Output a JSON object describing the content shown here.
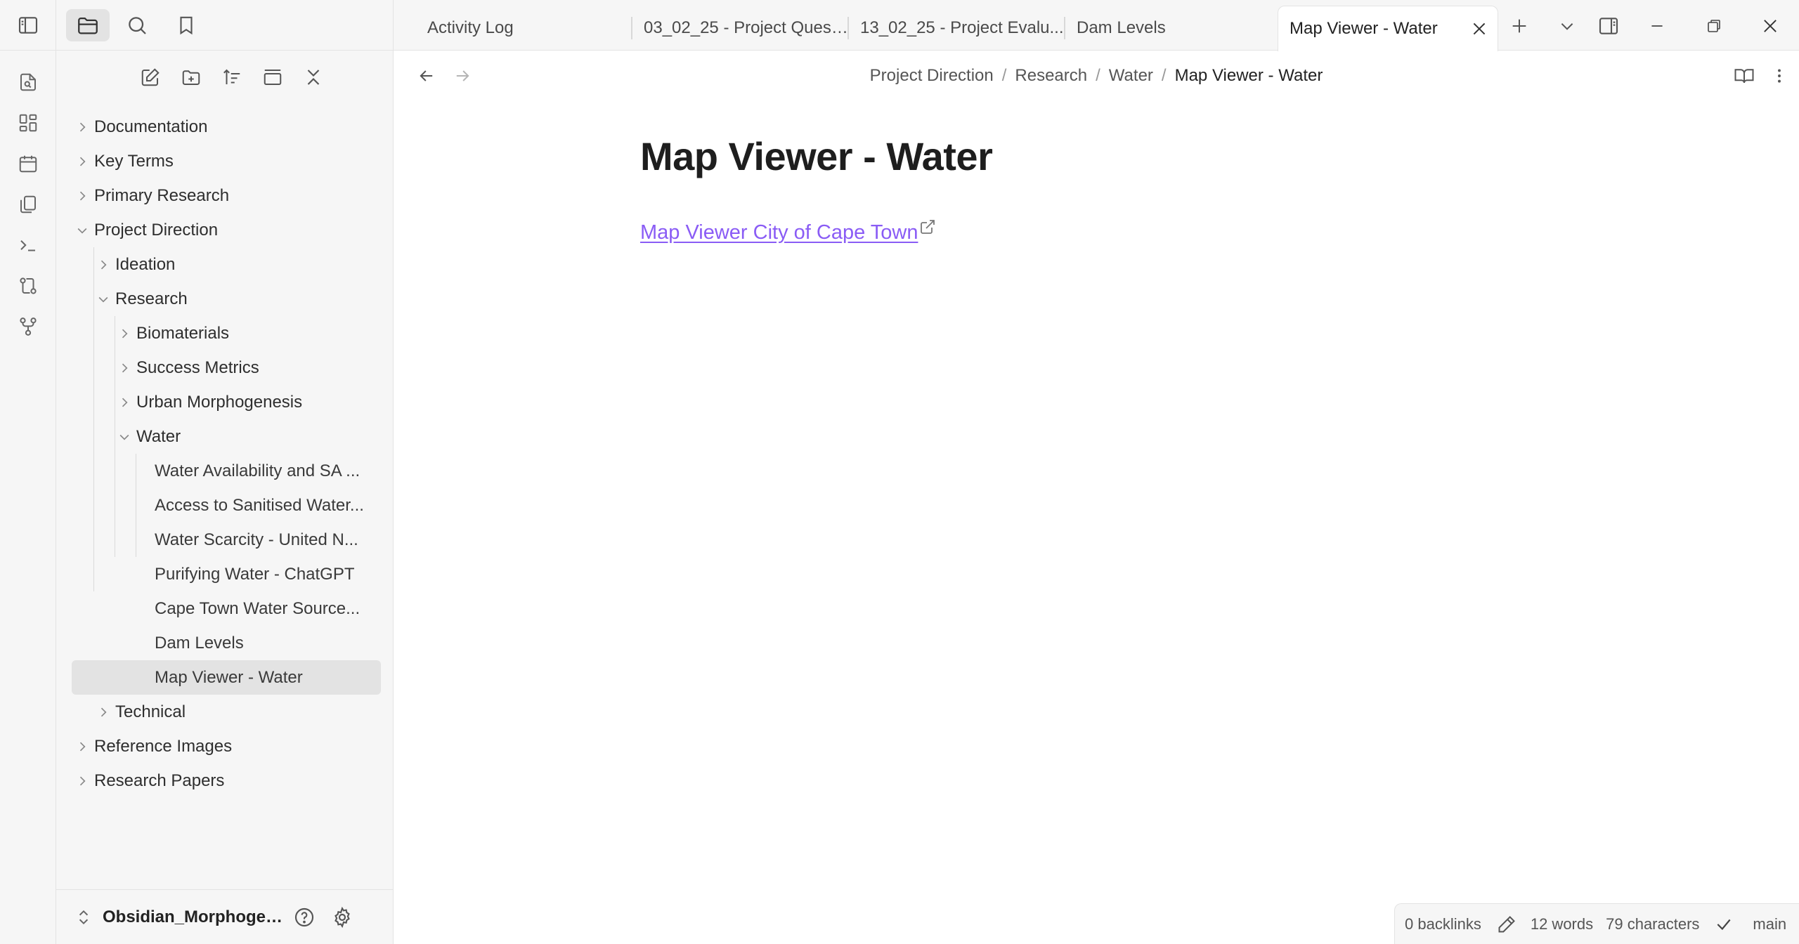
{
  "ribbon": {
    "toggle_sidebar": "sidebar-toggle-icon",
    "items": [
      {
        "name": "open-quick-switcher",
        "icon": "file-search-icon"
      },
      {
        "name": "open-canvas",
        "icon": "grid-icon"
      },
      {
        "name": "open-daily-note",
        "icon": "calendar-icon"
      },
      {
        "name": "open-templates",
        "icon": "copy-icon"
      },
      {
        "name": "open-command-palette",
        "icon": "terminal-icon"
      },
      {
        "name": "open-git",
        "icon": "git-compare-icon"
      },
      {
        "name": "open-graph",
        "icon": "git-fork-icon"
      }
    ]
  },
  "sidebar": {
    "tabs": [
      "files",
      "search",
      "bookmarks"
    ],
    "tree": [
      {
        "label": "Documentation",
        "type": "folder",
        "expanded": false,
        "depth": 0
      },
      {
        "label": "Key Terms",
        "type": "folder",
        "expanded": false,
        "depth": 0
      },
      {
        "label": "Primary Research",
        "type": "folder",
        "expanded": false,
        "depth": 0
      },
      {
        "label": "Project Direction",
        "type": "folder",
        "expanded": true,
        "depth": 0
      },
      {
        "label": "Ideation",
        "type": "folder",
        "expanded": false,
        "depth": 1
      },
      {
        "label": "Research",
        "type": "folder",
        "expanded": true,
        "depth": 1
      },
      {
        "label": "Biomaterials",
        "type": "folder",
        "expanded": false,
        "depth": 2
      },
      {
        "label": "Success Metrics",
        "type": "folder",
        "expanded": false,
        "depth": 2
      },
      {
        "label": "Urban Morphogenesis",
        "type": "folder",
        "expanded": false,
        "depth": 2
      },
      {
        "label": "Water",
        "type": "folder",
        "expanded": true,
        "depth": 2
      },
      {
        "label": "Water Availability and SA ...",
        "type": "file",
        "depth": 3
      },
      {
        "label": "Access to Sanitised Water...",
        "type": "file",
        "depth": 3
      },
      {
        "label": "Water Scarcity - United N...",
        "type": "file",
        "depth": 3
      },
      {
        "label": "Purifying Water - ChatGPT",
        "type": "file",
        "depth": 3
      },
      {
        "label": "Cape Town Water Source...",
        "type": "file",
        "depth": 3
      },
      {
        "label": "Dam Levels",
        "type": "file",
        "depth": 3
      },
      {
        "label": "Map Viewer - Water",
        "type": "file",
        "depth": 3,
        "selected": true
      },
      {
        "label": "Technical",
        "type": "folder",
        "expanded": false,
        "depth": 1
      },
      {
        "label": "Reference Images",
        "type": "folder",
        "expanded": false,
        "depth": 0
      },
      {
        "label": "Research Papers",
        "type": "folder",
        "expanded": false,
        "depth": 0
      }
    ],
    "vault_name": "Obsidian_Morphogen..."
  },
  "tabs": [
    {
      "label": "Activity Log"
    },
    {
      "label": "03_02_25 - Project Quest..."
    },
    {
      "label": "13_02_25 - Project Evalu..."
    },
    {
      "label": "Dam Levels"
    },
    {
      "label": "Map Viewer - Water",
      "active": true
    }
  ],
  "breadcrumb": [
    "Project Direction",
    "Research",
    "Water",
    "Map Viewer - Water"
  ],
  "note": {
    "title": "Map Viewer - Water",
    "link_text": "Map Viewer City of Cape Town"
  },
  "status": {
    "backlinks": "0 backlinks",
    "words": "12 words",
    "characters": "79 characters",
    "branch": "main"
  },
  "colors": {
    "link": "#8a5cf5",
    "sidebar_bg": "#f6f6f6",
    "selected_bg": "#e3e3e3"
  }
}
